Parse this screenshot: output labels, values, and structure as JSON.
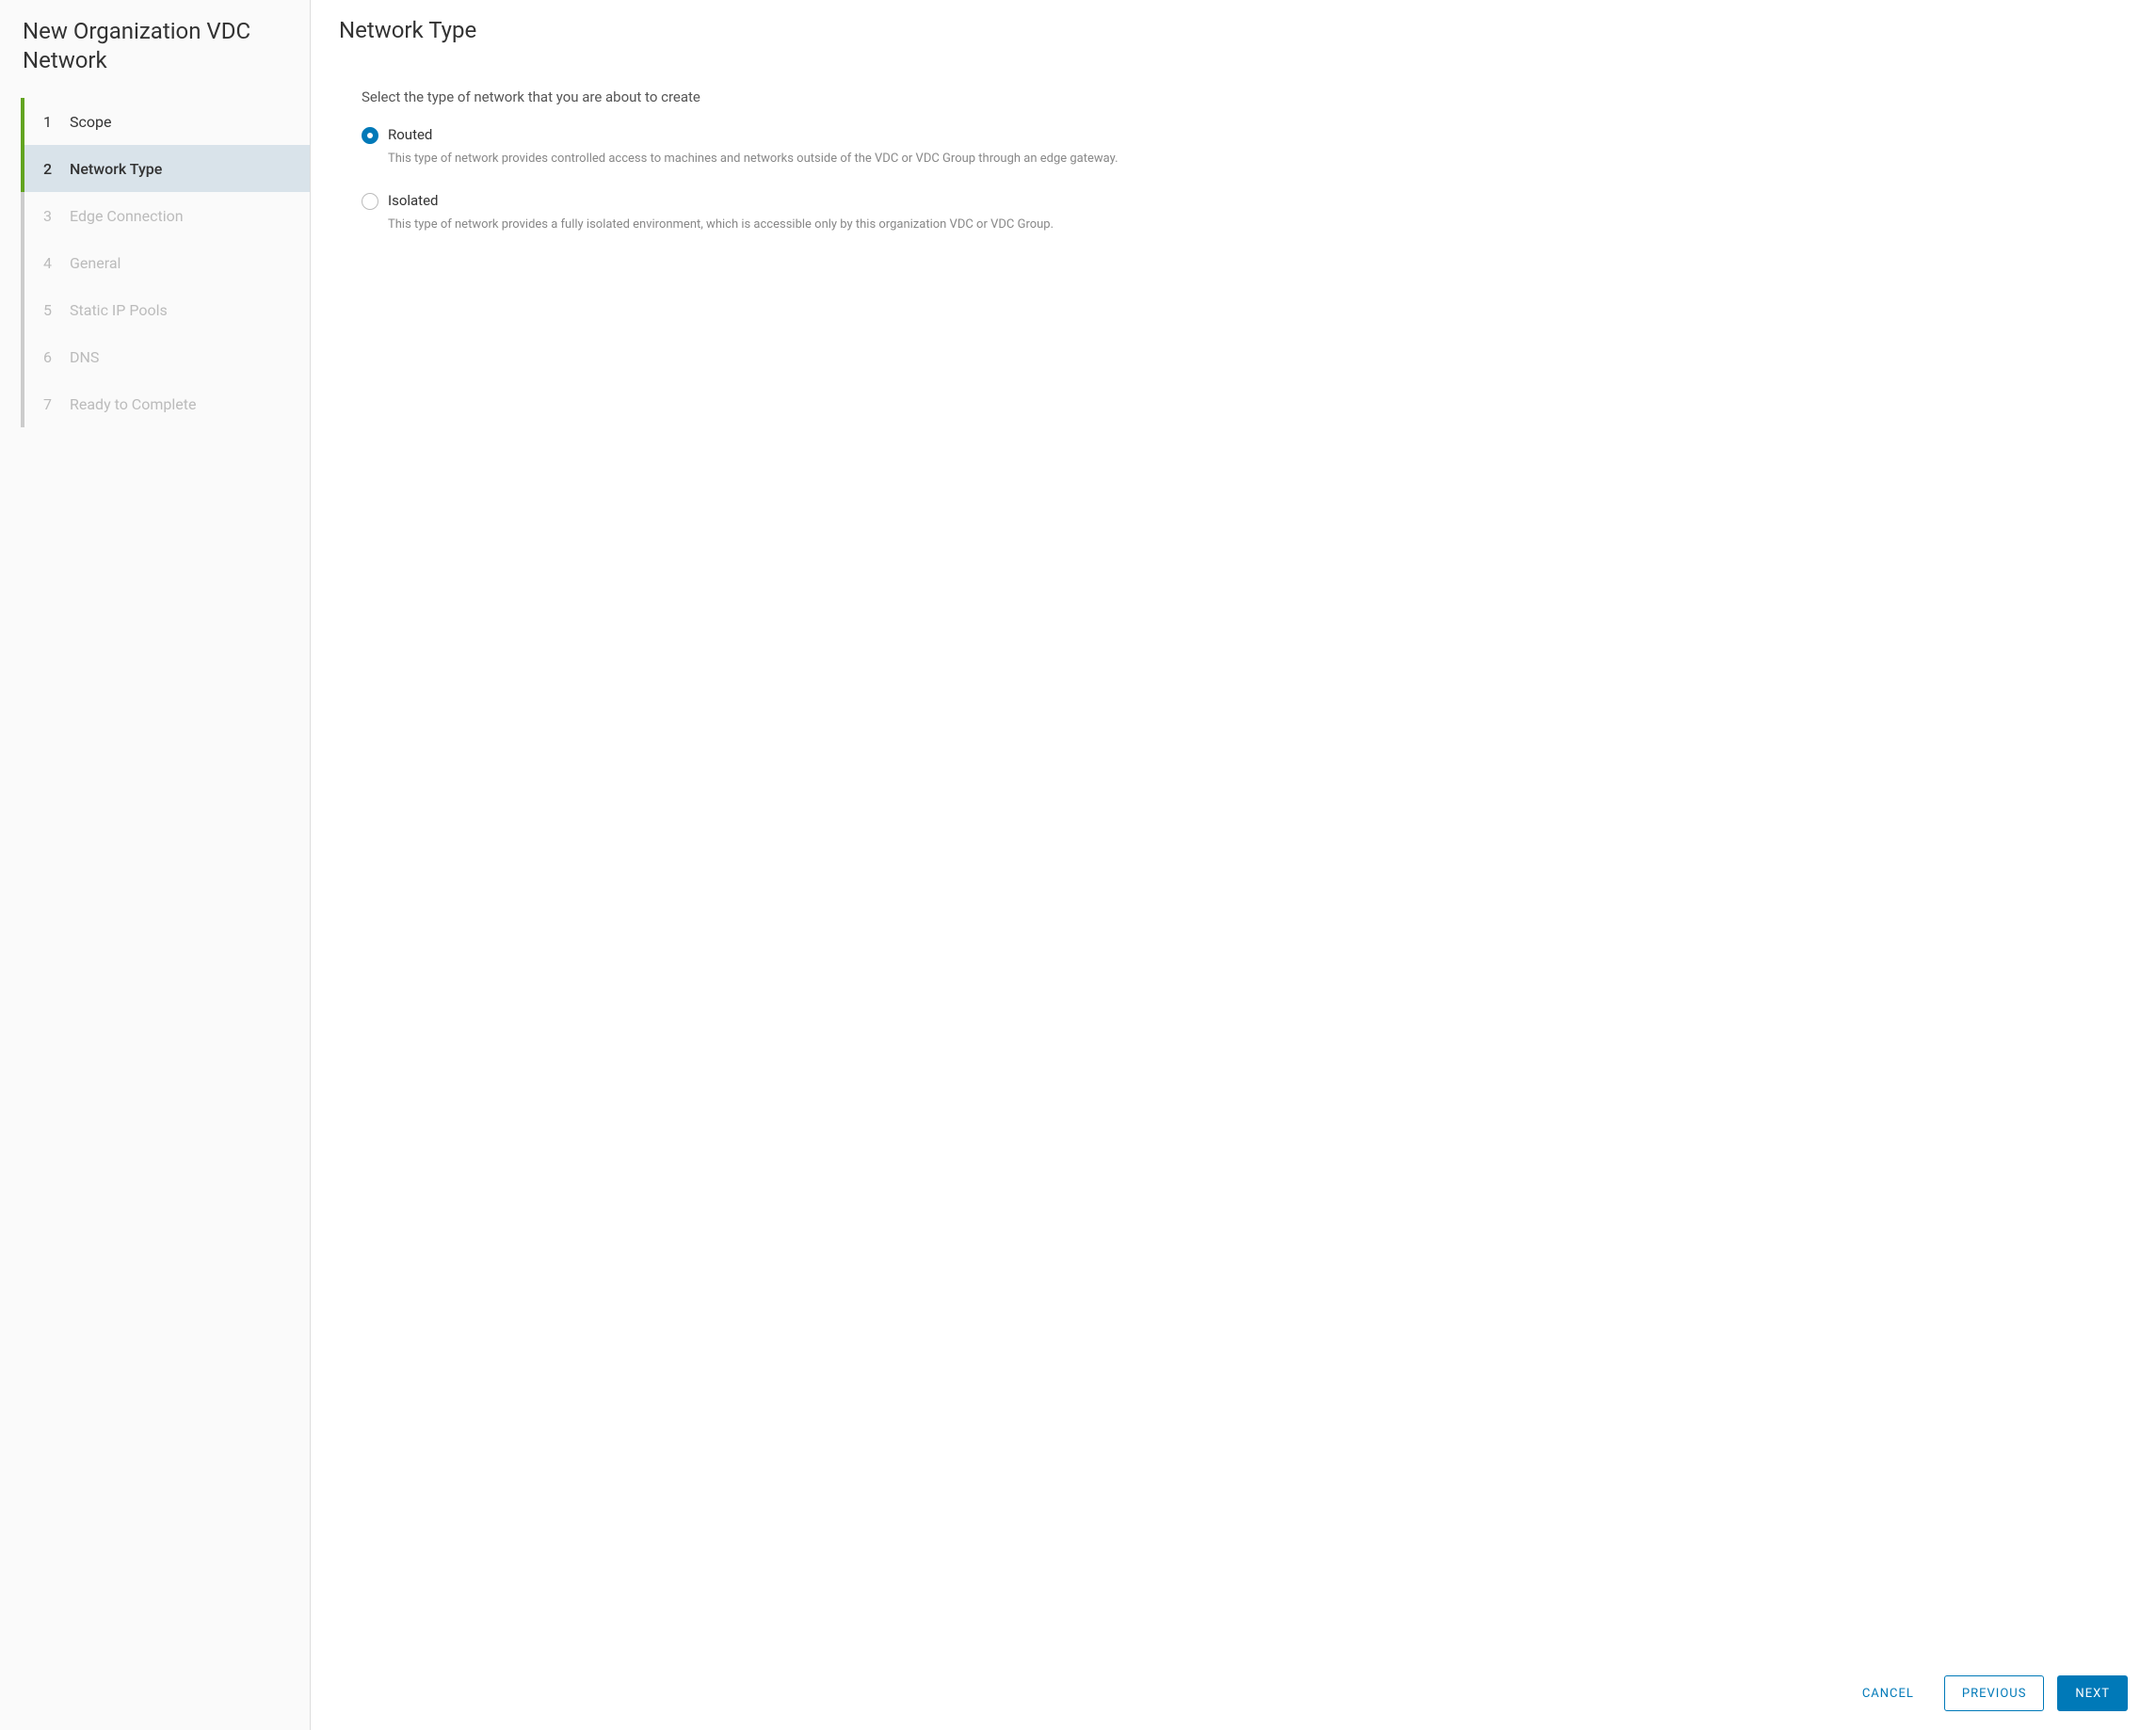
{
  "wizard": {
    "title": "New Organization VDC Network",
    "steps": [
      {
        "num": "1",
        "label": "Scope",
        "state": "completed"
      },
      {
        "num": "2",
        "label": "Network Type",
        "state": "active"
      },
      {
        "num": "3",
        "label": "Edge Connection",
        "state": "upcoming"
      },
      {
        "num": "4",
        "label": "General",
        "state": "upcoming"
      },
      {
        "num": "5",
        "label": "Static IP Pools",
        "state": "upcoming"
      },
      {
        "num": "6",
        "label": "DNS",
        "state": "upcoming"
      },
      {
        "num": "7",
        "label": "Ready to Complete",
        "state": "upcoming"
      }
    ]
  },
  "main": {
    "title": "Network Type",
    "instruction": "Select the type of network that you are about to create",
    "options": [
      {
        "label": "Routed",
        "selected": true,
        "description": "This type of network provides controlled access to machines and networks outside of the VDC or VDC Group through an edge gateway."
      },
      {
        "label": "Isolated",
        "selected": false,
        "description": "This type of network provides a fully isolated environment, which is accessible only by this organization VDC or VDC Group."
      }
    ]
  },
  "footer": {
    "cancel": "CANCEL",
    "previous": "PREVIOUS",
    "next": "NEXT"
  }
}
